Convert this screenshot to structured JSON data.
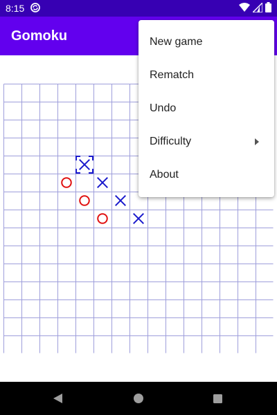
{
  "status_bar": {
    "time": "8:15",
    "background": "#3700b3",
    "icons": [
      "sync-icon",
      "wifi-icon",
      "cellular-icon",
      "battery-icon"
    ]
  },
  "app_bar": {
    "title": "Gomoku",
    "background": "#6200ee"
  },
  "board": {
    "cells": 15,
    "grid_color": "#9e9edb",
    "x_color": "#1a1acc",
    "o_color": "#e01010",
    "cursor_color": "#1a1acc",
    "stones": [
      {
        "row": 4,
        "col": 4,
        "player": "X"
      },
      {
        "row": 5,
        "col": 5,
        "player": "X"
      },
      {
        "row": 6,
        "col": 6,
        "player": "X"
      },
      {
        "row": 7,
        "col": 7,
        "player": "X"
      },
      {
        "row": 5,
        "col": 3,
        "player": "O"
      },
      {
        "row": 6,
        "col": 4,
        "player": "O"
      },
      {
        "row": 7,
        "col": 5,
        "player": "O"
      }
    ],
    "last_move": {
      "row": 4,
      "col": 4
    }
  },
  "menu": {
    "items": [
      {
        "label": "New game",
        "submenu": false
      },
      {
        "label": "Rematch",
        "submenu": false
      },
      {
        "label": "Undo",
        "submenu": false
      },
      {
        "label": "Difficulty",
        "submenu": true
      },
      {
        "label": "About",
        "submenu": false
      }
    ]
  },
  "nav_bar": {
    "icons": [
      "back-icon",
      "home-icon",
      "recents-icon"
    ]
  }
}
